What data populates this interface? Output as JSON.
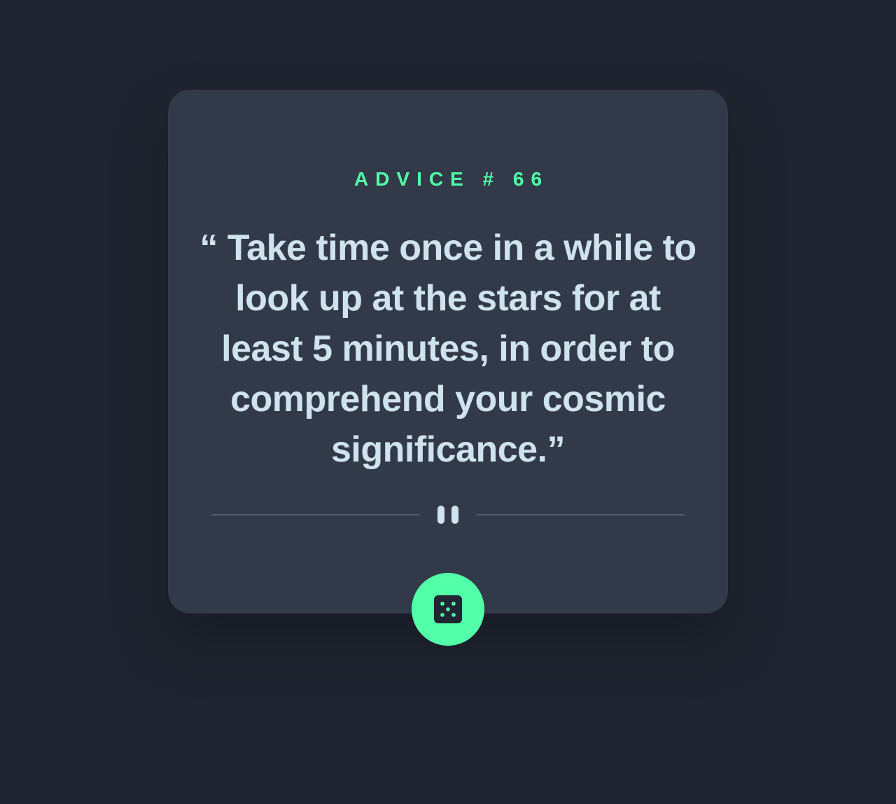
{
  "advice": {
    "label": "ADVICE # 66",
    "quote": "“ Take time once in a while to look up at the stars for at least 5 minutes, in order to comprehend your cosmic significance.”"
  },
  "button": {
    "icon": "dice-icon",
    "aria_label": "Get new advice"
  },
  "colors": {
    "background": "#1f2430",
    "card": "#323a4a",
    "accent": "#52ffa8",
    "text": "#cfe3ec",
    "divider": "#4f5d73"
  }
}
